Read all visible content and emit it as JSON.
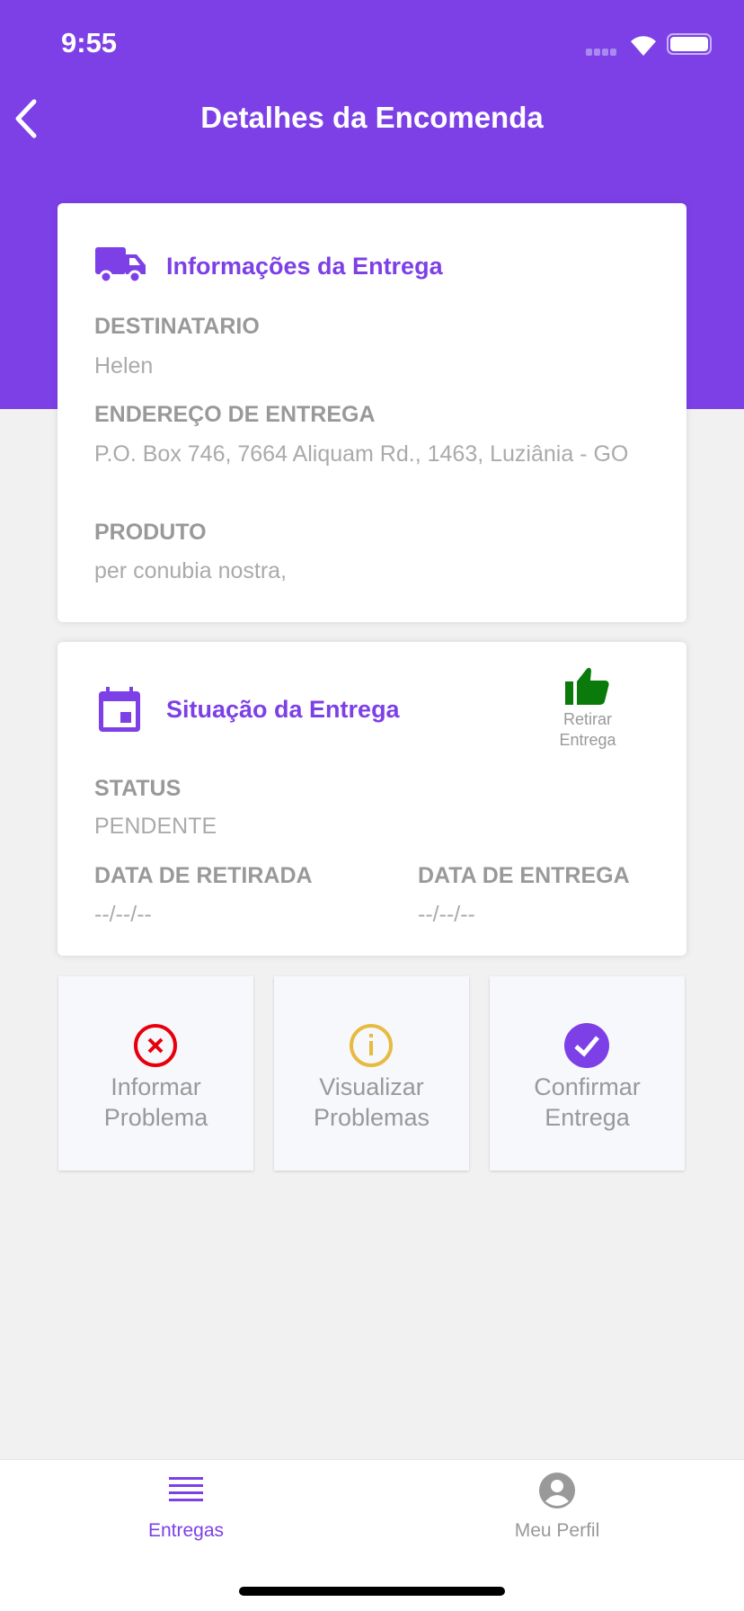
{
  "status_bar": {
    "time": "9:55"
  },
  "header": {
    "title": "Detalhes da Encomenda"
  },
  "delivery_info": {
    "title": "Informações da Entrega",
    "recipient_label": "DESTINATARIO",
    "recipient": "Helen",
    "address_label": "ENDEREÇO DE ENTREGA",
    "address": "P.O. Box 746, 7664 Aliquam Rd., 1463, Luziânia - GO",
    "product_label": "PRODUTO",
    "product": "per conubia nostra,"
  },
  "delivery_status": {
    "title": "Situação da Entrega",
    "withdraw_button": "Retirar Entrega",
    "status_label": "STATUS",
    "status": "PENDENTE",
    "withdraw_date_label": "DATA DE RETIRADA",
    "withdraw_date": "--/--/--",
    "delivery_date_label": "DATA DE ENTREGA",
    "delivery_date": "--/--/--"
  },
  "actions": [
    {
      "label": "Informar Problema",
      "color": "#e7000b"
    },
    {
      "label": "Visualizar Problemas",
      "color": "#e7ba40"
    },
    {
      "label": "Confirmar Entrega",
      "color": "#7d40e7"
    }
  ],
  "tabs": [
    {
      "label": "Entregas",
      "active": true
    },
    {
      "label": "Meu Perfil",
      "active": false
    }
  ],
  "colors": {
    "primary": "#7d40e7",
    "success": "#0a7a0a"
  }
}
